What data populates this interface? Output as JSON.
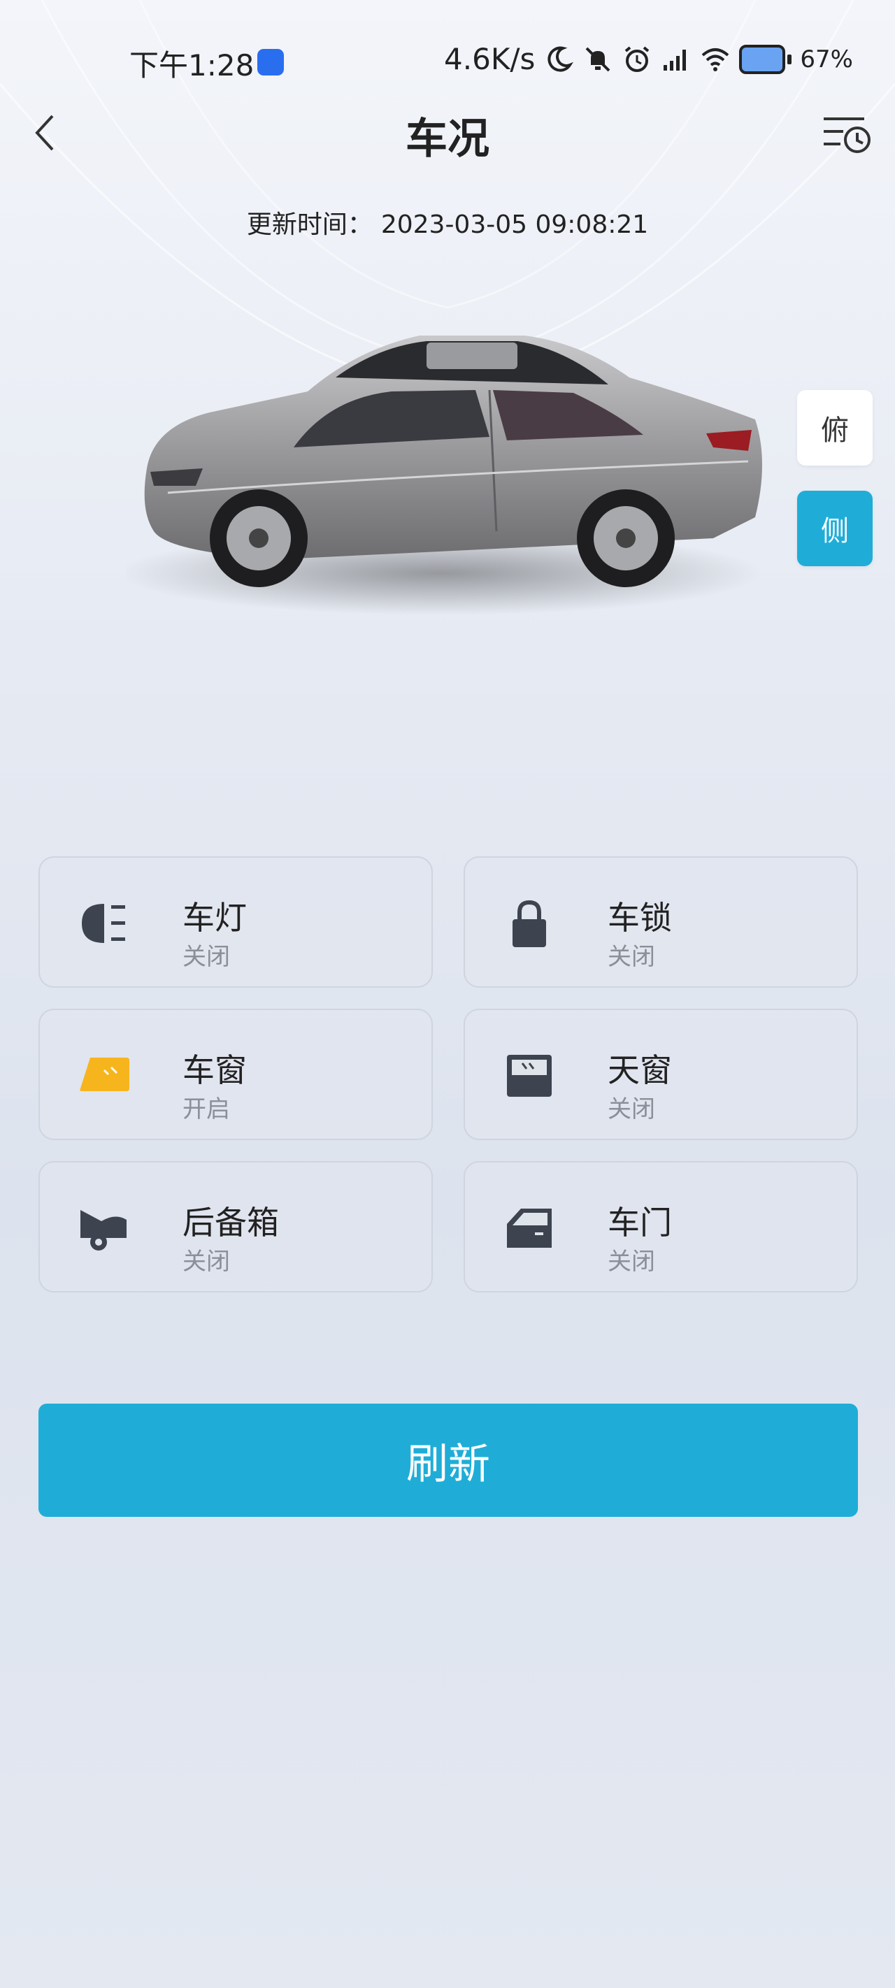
{
  "status_bar": {
    "time": "下午1:28",
    "speed": "4.6K/s",
    "battery": "67%",
    "icons": [
      "app-badge-icon",
      "moon-icon",
      "mute-bell-icon",
      "alarm-icon",
      "signal-icon",
      "wifi-icon",
      "battery-icon"
    ]
  },
  "header": {
    "title": "车况",
    "back_icon": "chevron-left-icon",
    "history_icon": "list-clock-icon"
  },
  "update": {
    "label": "更新时间：",
    "value": "2023-03-05 09:08:21"
  },
  "view_toggle": {
    "top_label": "俯",
    "side_label": "侧",
    "selected": "侧",
    "selected_color": "#1fadd8"
  },
  "items": [
    {
      "name": "车灯",
      "state": "关闭",
      "icon": "headlight-icon"
    },
    {
      "name": "车锁",
      "state": "关闭",
      "icon": "lock-icon"
    },
    {
      "name": "车窗",
      "state": "开启",
      "icon": "window-icon",
      "highlight_color": "#f7b51d"
    },
    {
      "name": "天窗",
      "state": "关闭",
      "icon": "sunroof-icon"
    },
    {
      "name": "后备箱",
      "state": "关闭",
      "icon": "trunk-icon"
    },
    {
      "name": "车门",
      "state": "关闭",
      "icon": "door-icon"
    }
  ],
  "refresh_label": "刷新",
  "colors": {
    "accent": "#1fadd8",
    "icon_dark": "#3d4450"
  }
}
